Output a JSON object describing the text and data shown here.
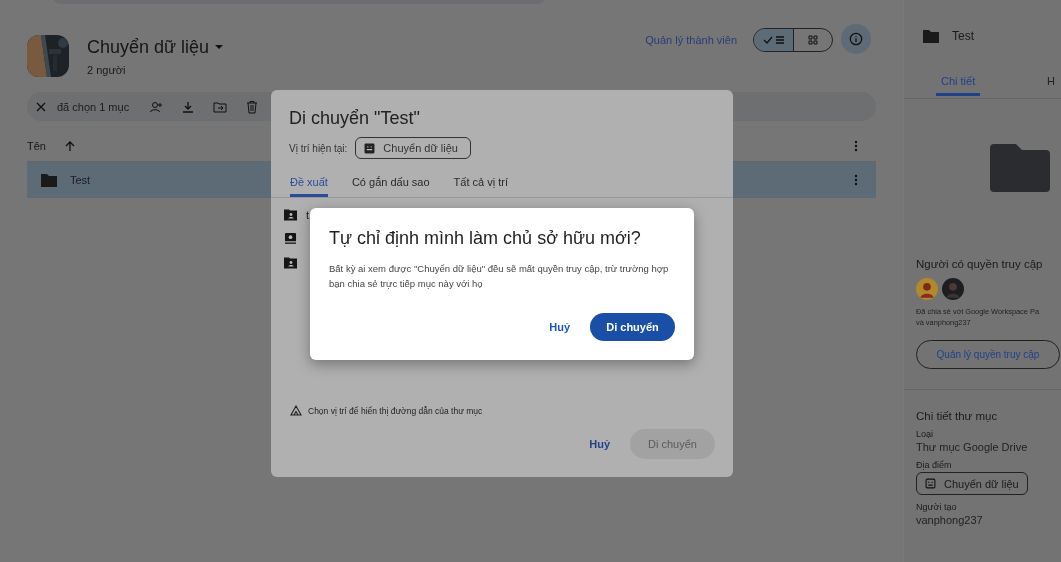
{
  "header": {
    "title": "Chuyển dữ liệu",
    "subtitle": "2 người",
    "manage_link": "Quản lý thành viên",
    "view_toggle": [
      {
        "kind": "list",
        "selected": true
      },
      {
        "kind": "grid",
        "selected": false
      }
    ],
    "details_open": true
  },
  "selection_bar": {
    "count_label": "đã chọn 1 mục"
  },
  "file_list": {
    "name_column": "Tên",
    "rows": [
      {
        "name": "Test",
        "selected": true
      }
    ]
  },
  "details_panel": {
    "title": "Test",
    "tabs": [
      {
        "label": "Chi tiết",
        "selected": true
      },
      {
        "label": "H",
        "selected": false
      }
    ],
    "access_heading": "Người có quyền truy cập",
    "shared_text": "Đã chia sẻ với Google Workspace Pa",
    "shared_text_2": "và vanphong237",
    "manage_access": "Quản lý quyền truy cập",
    "folder_heading": "Chi tiết thư mục",
    "fields": [
      {
        "kind": "text",
        "label": "Loại",
        "value": "Thư mục Google Drive"
      },
      {
        "kind": "chip",
        "label": "Địa điểm",
        "value": "Chuyển dữ liệu"
      },
      {
        "kind": "text",
        "label": "Người tạo",
        "value": "vanphong237"
      }
    ]
  },
  "move_dialog": {
    "title": "Di chuyển \"Test\"",
    "location_label": "Vị trí hiện tại:",
    "location": "Chuyển dữ liệu",
    "tabs": [
      {
        "label": "Đề xuất",
        "selected": true
      },
      {
        "label": "Có gắn dấu sao",
        "selected": false
      },
      {
        "label": "Tất cả vị trí",
        "selected": false
      }
    ],
    "items": [
      {
        "kind": "shared-folder",
        "label": "t"
      },
      {
        "kind": "drive"
      },
      {
        "kind": "shared-folder"
      }
    ],
    "hint": "Chọn vị trí để hiển thị đường dẫn của thư mục",
    "cancel": "Huỷ",
    "confirm": {
      "label": "Di chuyển",
      "disabled": true
    }
  },
  "confirm_dialog": {
    "title": "Tự chỉ định mình làm chủ sở hữu mới?",
    "body": "Bất kỳ ai xem được \"Chuyển dữ liệu\" đều sẽ mất quyền truy cập, trừ trường hợp bạn chia sẻ trực tiếp mục này với họ",
    "cancel": "Huỷ",
    "confirm": "Di chuyển"
  }
}
